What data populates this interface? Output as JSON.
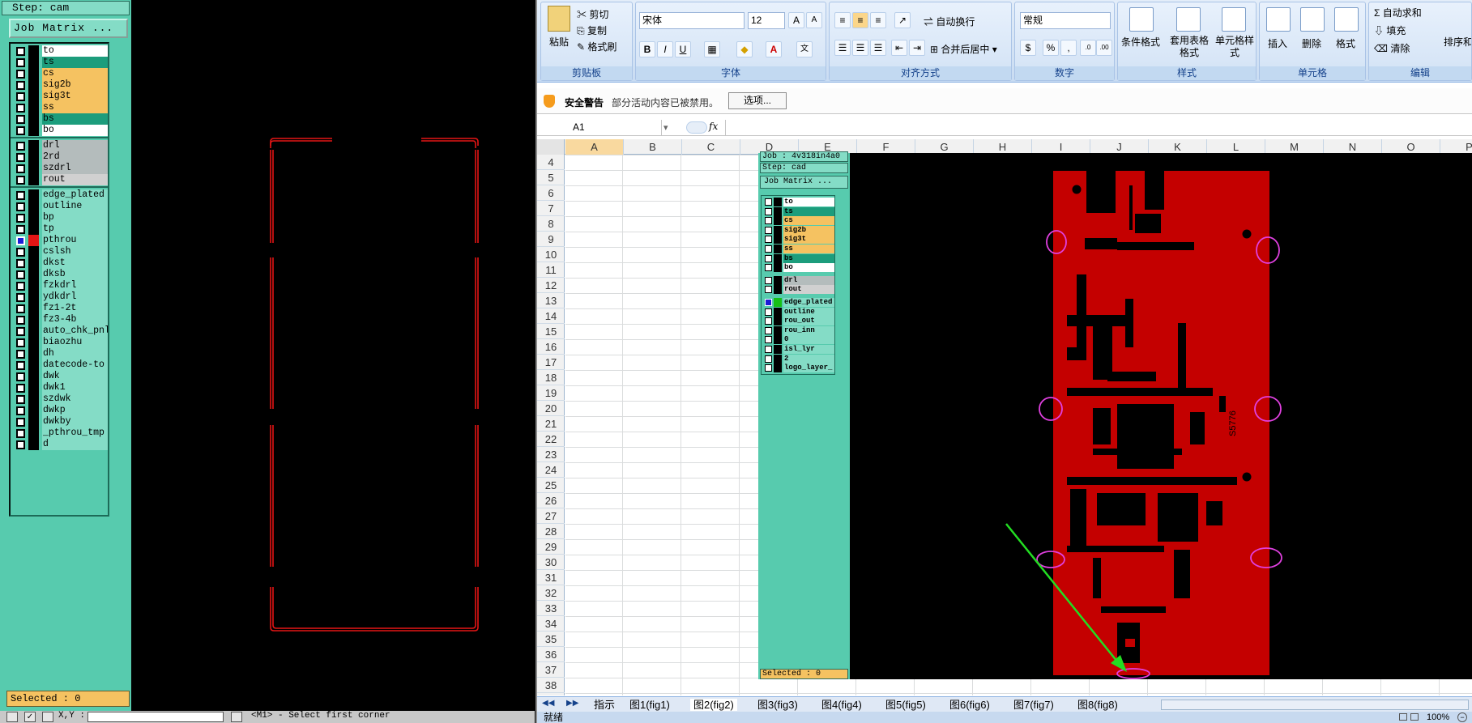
{
  "cam": {
    "step": "Step: cam",
    "job_matrix": "Job Matrix ...",
    "layers": [
      {
        "name": "to",
        "bg": "#ffffff"
      },
      {
        "name": "ts",
        "bg": "#1c9d7c"
      },
      {
        "name": "cs",
        "bg": "#f5c261"
      },
      {
        "name": "sig2b",
        "bg": "#f5c261"
      },
      {
        "name": "sig3t",
        "bg": "#f5c261"
      },
      {
        "name": "ss",
        "bg": "#f5c261"
      },
      {
        "name": "bs",
        "bg": "#1c9d7c"
      },
      {
        "name": "bo",
        "bg": "#ffffff"
      },
      {
        "name": "drl",
        "bg": "#b4bcbc"
      },
      {
        "name": "2rd",
        "bg": "#b4bcbc"
      },
      {
        "name": "szdrl",
        "bg": "#b4bcbc"
      },
      {
        "name": "rout",
        "bg": "#d0d0d0"
      },
      {
        "name": "edge_plated",
        "bg": "#84dcc6"
      },
      {
        "name": "outline",
        "bg": "#84dcc6"
      },
      {
        "name": "bp",
        "bg": "#84dcc6"
      },
      {
        "name": "tp",
        "bg": "#84dcc6"
      },
      {
        "name": "pthrou",
        "bg": "#84dcc6",
        "selected": true
      },
      {
        "name": "cslsh",
        "bg": "#84dcc6"
      },
      {
        "name": "dkst",
        "bg": "#84dcc6"
      },
      {
        "name": "dksb",
        "bg": "#84dcc6"
      },
      {
        "name": "fzkdrl",
        "bg": "#84dcc6"
      },
      {
        "name": "ydkdrl",
        "bg": "#84dcc6"
      },
      {
        "name": "fz1-2t",
        "bg": "#84dcc6"
      },
      {
        "name": "fz3-4b",
        "bg": "#84dcc6"
      },
      {
        "name": "auto_chk_pnl",
        "bg": "#84dcc6"
      },
      {
        "name": "biaozhu",
        "bg": "#84dcc6"
      },
      {
        "name": "dh",
        "bg": "#84dcc6"
      },
      {
        "name": "datecode-to",
        "bg": "#84dcc6"
      },
      {
        "name": "dwk",
        "bg": "#84dcc6"
      },
      {
        "name": "dwk1",
        "bg": "#84dcc6"
      },
      {
        "name": "szdwk",
        "bg": "#84dcc6"
      },
      {
        "name": "dwkp",
        "bg": "#84dcc6"
      },
      {
        "name": "dwkby",
        "bg": "#84dcc6"
      },
      {
        "name": "_pthrou_tmp",
        "bg": "#84dcc6"
      },
      {
        "name": "d",
        "bg": "#84dcc6"
      }
    ],
    "selected": "Selected : 0",
    "status": {
      "coords": "X,Y :",
      "hint": "<M1> - Select first corner"
    }
  },
  "excel": {
    "ribbon": {
      "clipboard": {
        "title": "剪贴板",
        "paste": "粘贴",
        "cut": "剪切",
        "copy": "复制",
        "format_painter": "格式刷"
      },
      "font": {
        "title": "字体",
        "family": "宋体",
        "size": "12"
      },
      "alignment": {
        "title": "对齐方式",
        "wrap": "自动换行",
        "merge": "合并后居中"
      },
      "number": {
        "title": "数字",
        "format": "常规"
      },
      "styles": {
        "title": "样式",
        "conditional": "条件格式",
        "table": "套用表格格式",
        "cell_style": "单元格样式"
      },
      "cells": {
        "title": "单元格",
        "insert": "插入",
        "delete": "删除",
        "format": "格式"
      },
      "editing": {
        "title": "编辑",
        "autosum": "自动求和",
        "fill": "填充",
        "clear": "清除",
        "sort": "排序和筛选"
      }
    },
    "security": {
      "title": "安全警告",
      "message": "部分活动内容已被禁用。",
      "options": "选项..."
    },
    "name_box": "A1",
    "columns": [
      "A",
      "B",
      "C",
      "D",
      "E",
      "F",
      "G",
      "H",
      "I",
      "J",
      "K",
      "L",
      "M",
      "N",
      "O",
      "P"
    ],
    "rows": [
      "4",
      "5",
      "6",
      "7",
      "8",
      "9",
      "10",
      "11",
      "12",
      "13",
      "14",
      "15",
      "16",
      "17",
      "18",
      "19",
      "20",
      "21",
      "22",
      "23",
      "24",
      "25",
      "26",
      "27",
      "28",
      "29",
      "30",
      "31",
      "32",
      "33",
      "34",
      "35",
      "36",
      "37",
      "38"
    ],
    "sheets": [
      "指示",
      "图1(fig1)",
      "图2(fig2)",
      "图3(fig3)",
      "图4(fig4)",
      "图5(fig5)",
      "图6(fig6)",
      "图7(fig7)",
      "图8(fig8)"
    ],
    "status": "就绪",
    "zoom": "100%",
    "picture": {
      "job": "Job : 4v318in4a0",
      "step": "Step: cad",
      "job_matrix": "Job Matrix ...",
      "layers": [
        {
          "name": "to",
          "bg": "#ffffff"
        },
        {
          "name": "ts",
          "bg": "#1c9d7c"
        },
        {
          "name": "cs",
          "bg": "#f5c261"
        },
        {
          "name": "sig2b",
          "bg": "#f5c261"
        },
        {
          "name": "sig3t",
          "bg": "#f5c261"
        },
        {
          "name": "ss",
          "bg": "#f5c261"
        },
        {
          "name": "bs",
          "bg": "#1c9d7c"
        },
        {
          "name": "bo",
          "bg": "#ffffff"
        },
        {
          "name": "drl",
          "bg": "#b4bcbc"
        },
        {
          "name": "rout",
          "bg": "#d0d0d0"
        },
        {
          "name": "edge_plated",
          "bg": "#84dcc6",
          "selected": true
        },
        {
          "name": "outline",
          "bg": "#84dcc6"
        },
        {
          "name": "rou_out",
          "bg": "#84dcc6"
        },
        {
          "name": "rou_inn",
          "bg": "#84dcc6"
        },
        {
          "name": "0",
          "bg": "#84dcc6"
        },
        {
          "name": "isl_lyr",
          "bg": "#84dcc6"
        },
        {
          "name": "2",
          "bg": "#84dcc6"
        },
        {
          "name": "logo_layer_",
          "bg": "#84dcc6"
        }
      ],
      "selected": "Selected : 0",
      "board_mark": "S5776"
    }
  }
}
